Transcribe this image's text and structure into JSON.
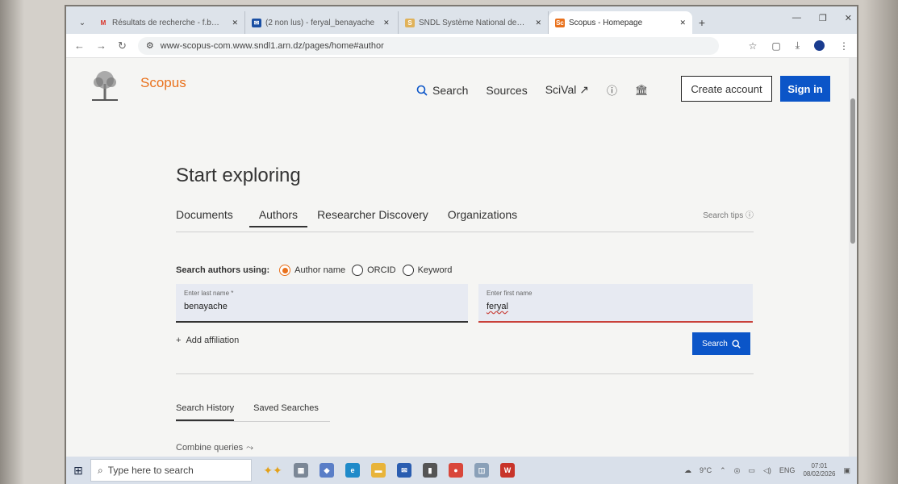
{
  "browser": {
    "tabs": [
      {
        "title": "Résultats de recherche - f.bena",
        "favicon": "gmail-icon",
        "color": "#d93025"
      },
      {
        "title": "(2 non lus) - feryal_benayache",
        "favicon": "mail-icon",
        "color": "#1a4fa3"
      },
      {
        "title": "SNDL Système National de Doc",
        "favicon": "sndl-icon",
        "color": "#e0b25a"
      },
      {
        "title": "Scopus - Homepage",
        "favicon": "scopus-icon",
        "color": "#e9711c",
        "active": true
      }
    ],
    "url": "www-scopus-com.www.sndl1.arn.dz/pages/home#author"
  },
  "header": {
    "brand": "Scopus",
    "nav": {
      "search": "Search",
      "sources": "Sources",
      "scival": "SciVal ↗"
    },
    "create_account": "Create account",
    "sign_in": "Sign in"
  },
  "main": {
    "title": "Start exploring",
    "tabs": [
      "Documents",
      "Authors",
      "Researcher Discovery",
      "Organizations"
    ],
    "active_tab": "Authors",
    "search_tips": "Search tips ⓘ",
    "search_using_label": "Search authors using:",
    "options": [
      "Author name",
      "ORCID",
      "Keyword"
    ],
    "selected_option": "Author name",
    "last_name": {
      "label": "Enter last name *",
      "value": "benayache"
    },
    "first_name": {
      "label": "Enter first name",
      "value": "feryal"
    },
    "add_affiliation": "Add affiliation",
    "search_button": "Search",
    "history_tabs": [
      "Search History",
      "Saved Searches"
    ],
    "combine_queries": "Combine queries"
  },
  "taskbar": {
    "search_placeholder": "Type here to search",
    "weather": "9°C",
    "lang": "ENG",
    "time": "07:01",
    "date": "08/02/2026"
  }
}
